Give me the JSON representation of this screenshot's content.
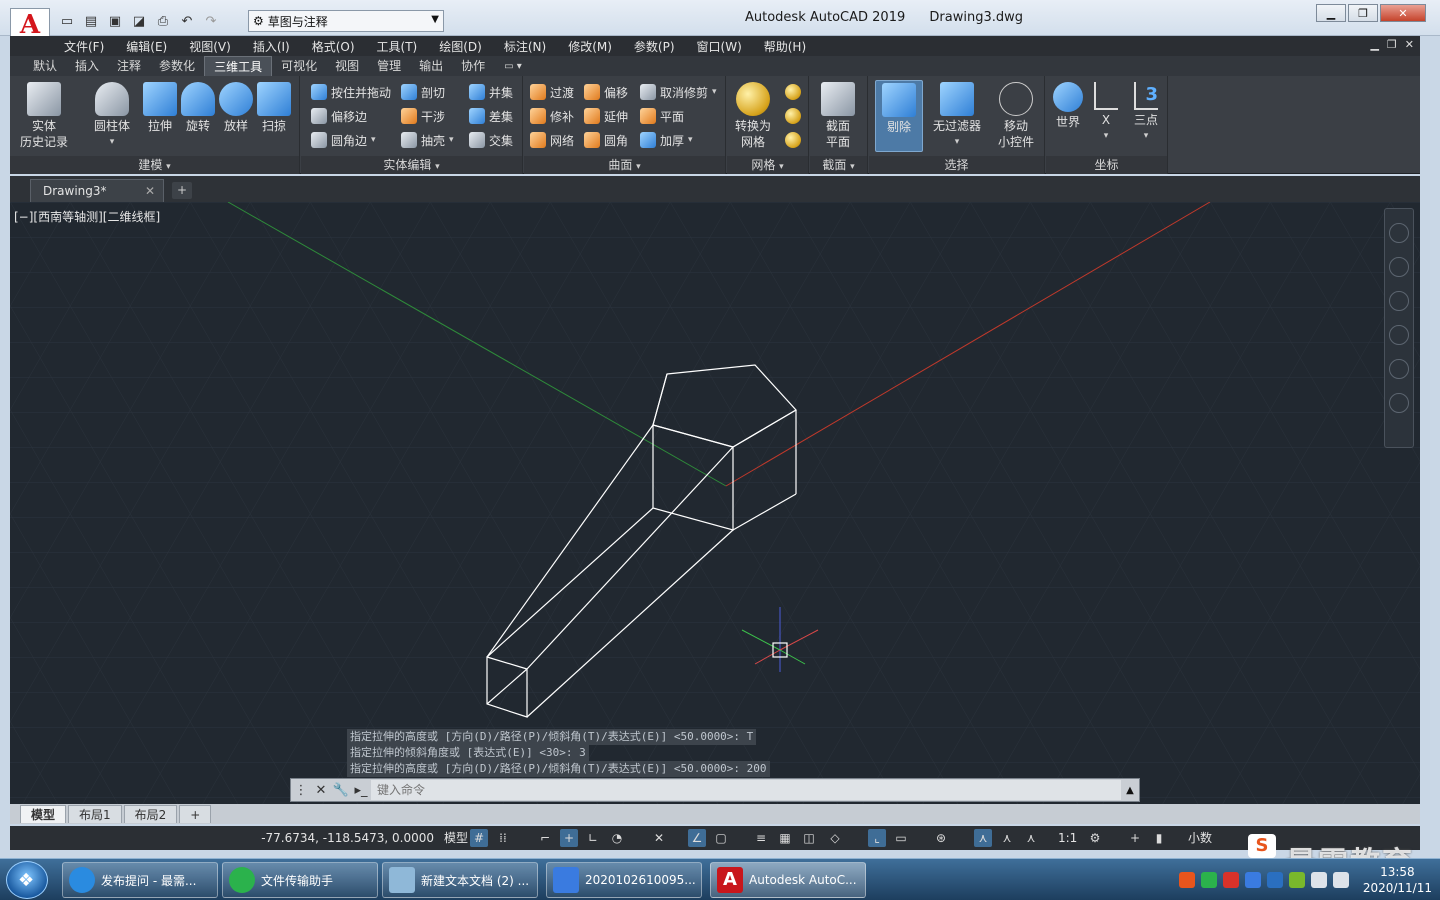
{
  "titlebar": {
    "logo_letter": "A",
    "workspace": "草图与注释",
    "title": "Autodesk AutoCAD 2019",
    "filename": "Drawing3.dwg"
  },
  "menu": [
    "文件(F)",
    "编辑(E)",
    "视图(V)",
    "插入(I)",
    "格式(O)",
    "工具(T)",
    "绘图(D)",
    "标注(N)",
    "修改(M)",
    "参数(P)",
    "窗口(W)",
    "帮助(H)"
  ],
  "ribbon_tabs": [
    "默认",
    "插入",
    "注释",
    "参数化",
    "三维工具",
    "可视化",
    "视图",
    "管理",
    "输出",
    "协作"
  ],
  "active_tab": "三维工具",
  "panels": {
    "modeling": {
      "title": "建模",
      "history": [
        "实体",
        "历史记录"
      ],
      "cylinder": "圆柱体",
      "extrude": "拉伸",
      "revolve": "旋转",
      "loft": "放样",
      "sweep": "扫掠"
    },
    "solid_edit": {
      "title": "实体编辑",
      "presspull": "按住并拖动",
      "offset_edge": "偏移边",
      "fillet_edge": "圆角边",
      "slice": "剖切",
      "interfere": "干涉",
      "shell": "抽壳",
      "union": "并集",
      "subtract": "差集",
      "intersect": "交集"
    },
    "surface": {
      "title": "曲面",
      "blend": "过渡",
      "offset": "偏移",
      "untrim": "取消修剪",
      "patch": "修补",
      "extend": "延伸",
      "planar": "平面",
      "network": "网络",
      "fillet": "圆角",
      "thicken": "加厚"
    },
    "mesh": {
      "title": "网格",
      "convert": [
        "转换为",
        "网格"
      ]
    },
    "section": {
      "title": "截面",
      "plane": [
        "截面",
        "平面"
      ]
    },
    "selection": {
      "title": "选择",
      "cull": "剔除",
      "no_filter": "无过滤器",
      "gizmo": [
        "移动",
        "小控件"
      ]
    },
    "coordinates": {
      "title": "坐标",
      "world": "世界",
      "x": "X",
      "three_point": "三点",
      "three_label": "3"
    }
  },
  "document_tab": "Drawing3*",
  "viewport_label": "[−][西南等轴测][二维线框]",
  "command_history": [
    "指定拉伸的高度或 [方向(D)/路径(P)/倾斜角(T)/表达式(E)] <50.0000>: T",
    "指定拉伸的倾斜角度或 [表达式(E)] <30>: 3",
    "指定拉伸的高度或 [方向(D)/路径(P)/倾斜角(T)/表达式(E)] <50.0000>: 200"
  ],
  "command_placeholder": "键入命令",
  "layout_tabs": [
    "模型",
    "布局1",
    "布局2"
  ],
  "status": {
    "coords": "-77.6734, -118.5473, 0.0000",
    "model": "模型",
    "scale": "1:1",
    "units": "小数"
  },
  "watermark": {
    "icon_letter": "S",
    "text": "最需教育"
  },
  "taskbar": {
    "items": [
      {
        "label": "发布提问 - 最需...",
        "icon": "ie-icon",
        "color": "#2a8be0"
      },
      {
        "label": "文件传输助手",
        "icon": "wechat-icon",
        "color": "#2bb24c"
      },
      {
        "label": "新建文本文档 (2) ...",
        "icon": "notepad-icon",
        "color": "#8fb8d8"
      },
      {
        "label": "2020102610095...",
        "icon": "video-icon",
        "color": "#3a7be0"
      },
      {
        "label": "Autodesk AutoC...",
        "icon": "autocad-icon",
        "color": "#c8161c"
      }
    ],
    "time": "13:58",
    "date": "2020/11/11"
  },
  "colors": {
    "canvas": "#212830",
    "ribbon": "#3b3f45",
    "wireframe": "#ffffff",
    "x_axis": "#c0392b",
    "y_axis": "#2e8b3a",
    "accent": "#3f6d96"
  }
}
